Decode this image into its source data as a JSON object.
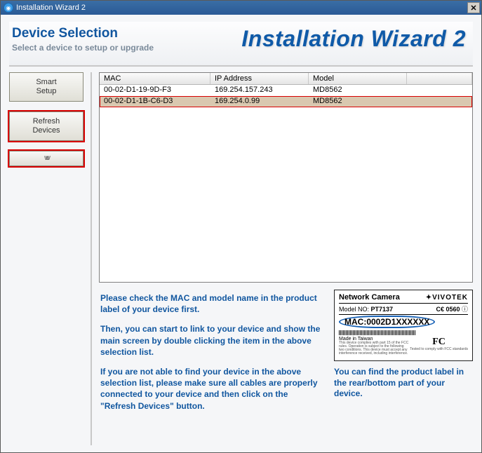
{
  "window": {
    "title": "Installation Wizard 2"
  },
  "header": {
    "title": "Device Selection",
    "subtitle": "Select a device to setup or upgrade",
    "brand": "Installation Wizard 2"
  },
  "sidebar": {
    "smart_setup_line1": "Smart",
    "smart_setup_line2": "Setup",
    "refresh_line1": "Refresh",
    "refresh_line2": "Devices"
  },
  "table": {
    "columns": {
      "mac": "MAC",
      "ip": "IP Address",
      "model": "Model"
    },
    "rows": [
      {
        "mac": "00-02-D1-19-9D-F3",
        "ip": "169.254.157.243",
        "model": "MD8562",
        "selected": false
      },
      {
        "mac": "00-02-D1-1B-C6-D3",
        "ip": "169.254.0.99",
        "model": "MD8562",
        "selected": true
      }
    ]
  },
  "instructions": {
    "p1": "Please check the MAC and model name in the product label of your device first.",
    "p2": "Then, you can start to link to your device and show the main screen by double clicking the item in the above selection list.",
    "p3": "If you are not able to find your device in the above selection list, please make sure all cables are properly connected to your device and then click on the \"Refresh Devices\" button."
  },
  "product_label": {
    "title": "Network Camera",
    "brand": "✦VIVOTEK",
    "model_line_label": "Model NO:",
    "model_no": "PT7137",
    "ce": "C€ 0560",
    "mac_label": "MAC:",
    "mac_value": "0002D1XXXXXX",
    "made_in": "Made in Taiwan",
    "caption": "You can find the product label in the rear/bottom part of your device."
  }
}
